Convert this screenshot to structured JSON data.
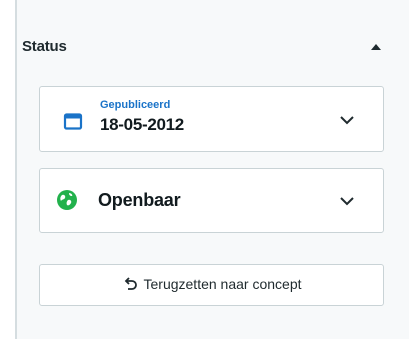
{
  "status": {
    "title": "Status",
    "collapse_icon": "chevron-up-icon"
  },
  "publish_date": {
    "caption": "Gepubliceerd",
    "value": "18-05-2012",
    "icon": "calendar-icon",
    "dropdown_icon": "chevron-down-icon"
  },
  "visibility": {
    "label": "Openbaar",
    "icon": "globe-icon",
    "dropdown_icon": "chevron-down-icon"
  },
  "revert": {
    "label": "Terugzetten naar concept",
    "icon": "undo-icon"
  },
  "colors": {
    "accent": "#1a73c8",
    "globe": "#22b14c",
    "border": "#c9d3d6",
    "panel_background": "#f7f9fa"
  }
}
